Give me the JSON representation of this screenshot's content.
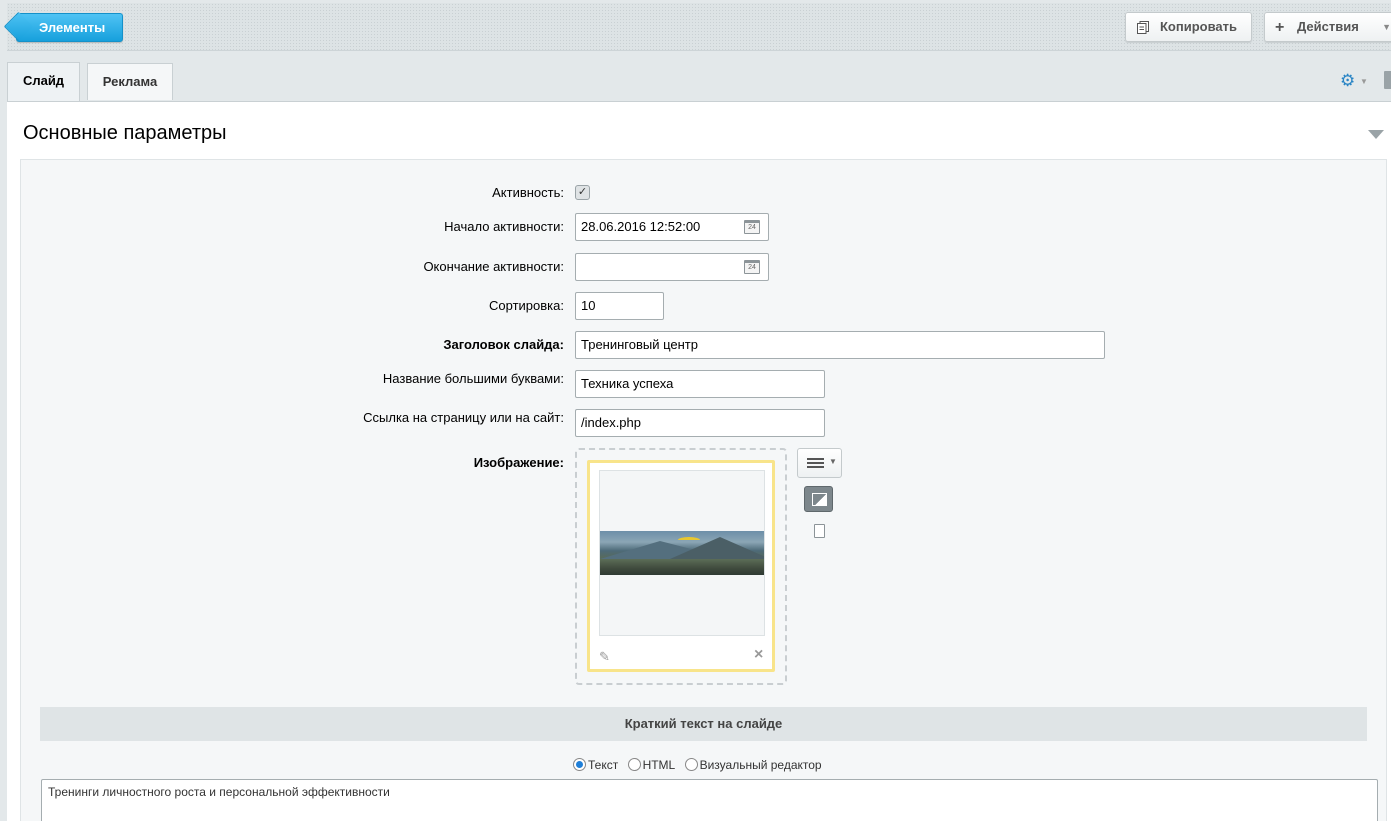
{
  "toolbar": {
    "back_label": "Элементы",
    "copy_label": "Копировать",
    "actions_label": "Действия"
  },
  "tabs": [
    {
      "label": "Слайд",
      "active": true
    },
    {
      "label": "Реклама",
      "active": false
    }
  ],
  "section": {
    "title": "Основные параметры"
  },
  "form": {
    "active": {
      "label": "Активность:",
      "checked": true
    },
    "start": {
      "label": "Начало активности:",
      "value": "28.06.2016 12:52:00"
    },
    "end": {
      "label": "Окончание активности:",
      "value": ""
    },
    "sort": {
      "label": "Сортировка:",
      "value": "10"
    },
    "title": {
      "label": "Заголовок слайда:",
      "value": "Тренинговый центр"
    },
    "caps": {
      "label": "Название большими буквами:",
      "value": "Техника успеха"
    },
    "link": {
      "label": "Ссылка на страницу или на сайт:",
      "value": "/index.php"
    },
    "image": {
      "label": "Изображение:"
    }
  },
  "short_text": {
    "header": "Краткий текст на слайде",
    "modes": [
      "Текст",
      "HTML",
      "Визуальный редактор"
    ],
    "selected_mode": "Текст",
    "value": "Тренинги личностного роста и персональной эффективности"
  },
  "icons": {
    "calendar_day": "24"
  },
  "colors": {
    "accent": "#17a0dc",
    "image_highlight": "#f8e48a"
  }
}
